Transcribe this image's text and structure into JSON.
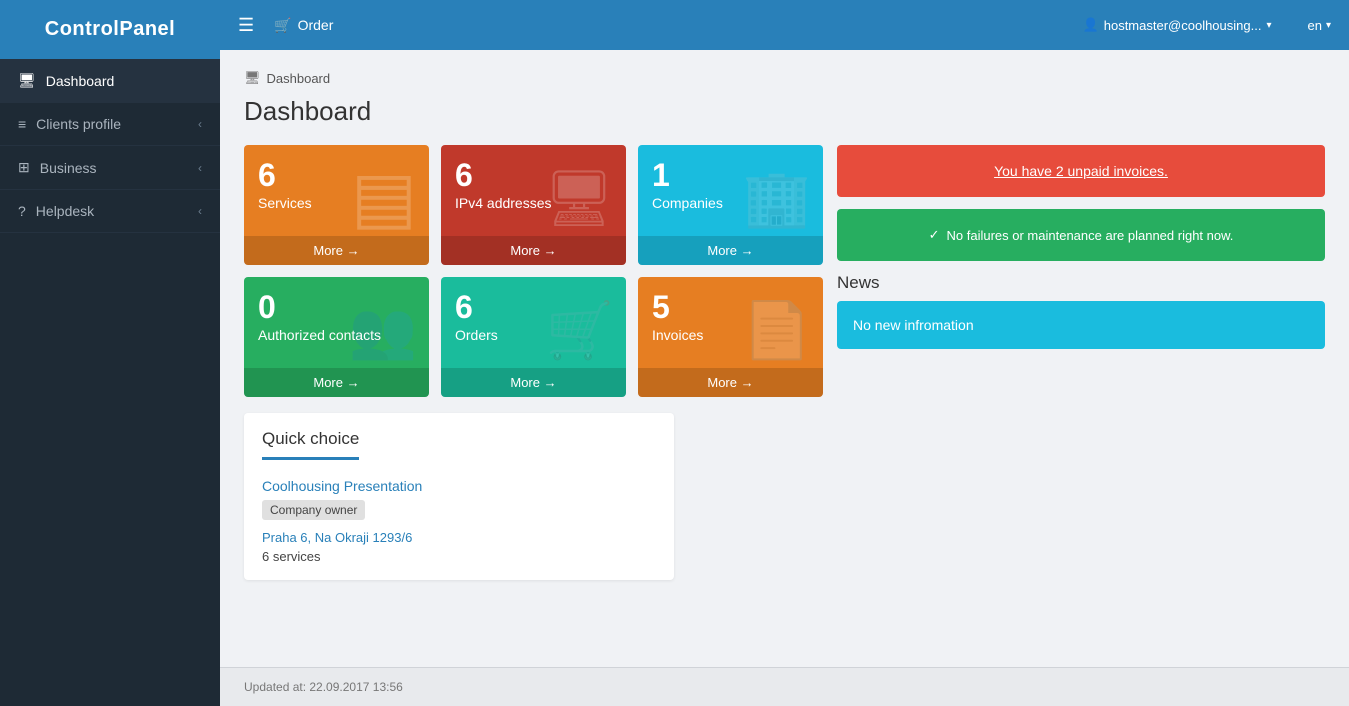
{
  "app": {
    "name": "ControlPanel"
  },
  "topbar": {
    "order_label": "Order",
    "user": "hostmaster@coolhousing...",
    "lang": "en"
  },
  "sidebar": {
    "items": [
      {
        "id": "dashboard",
        "icon": "🖥",
        "label": "Dashboard",
        "active": true,
        "has_chevron": false
      },
      {
        "id": "clients-profile",
        "icon": "≡",
        "label": "Clients profile",
        "active": false,
        "has_chevron": true
      },
      {
        "id": "business",
        "icon": "⊞",
        "label": "Business",
        "active": false,
        "has_chevron": true
      },
      {
        "id": "helpdesk",
        "icon": "?",
        "label": "Helpdesk",
        "active": false,
        "has_chevron": true
      }
    ]
  },
  "breadcrumb": {
    "icon": "🖥",
    "label": "Dashboard"
  },
  "page": {
    "title": "Dashboard"
  },
  "cards": [
    {
      "id": "services",
      "count": "6",
      "label": "Services",
      "more": "More →",
      "color": "card-orange",
      "bg_icon": "▤"
    },
    {
      "id": "ipv4",
      "count": "6",
      "label": "IPv4 addresses",
      "more": "More →",
      "color": "card-red",
      "bg_icon": "🖥"
    },
    {
      "id": "companies",
      "count": "1",
      "label": "Companies",
      "more": "More →",
      "color": "card-cyan",
      "bg_icon": "🏢"
    },
    {
      "id": "auth-contacts",
      "count": "0",
      "label": "Authorized contacts",
      "more": "More →",
      "color": "card-green",
      "bg_icon": "👥"
    },
    {
      "id": "orders",
      "count": "6",
      "label": "Orders",
      "more": "More →",
      "color": "card-teal",
      "bg_icon": "🛒"
    },
    {
      "id": "invoices",
      "count": "5",
      "label": "Invoices",
      "more": "More →",
      "color": "card-orange2",
      "bg_icon": "📄"
    }
  ],
  "alerts": {
    "unpaid": "You have 2 unpaid invoices.",
    "maintenance": "No failures or maintenance are planned right now."
  },
  "news": {
    "title": "News",
    "content": "No new infromation"
  },
  "quick_choice": {
    "title": "Quick choice",
    "company_name": "Coolhousing Presentation",
    "badge": "Company owner",
    "address": "Praha 6, Na Okraji 1293/6",
    "services": "6 services"
  },
  "footer": {
    "updated": "Updated at: 22.09.2017 13:56"
  }
}
